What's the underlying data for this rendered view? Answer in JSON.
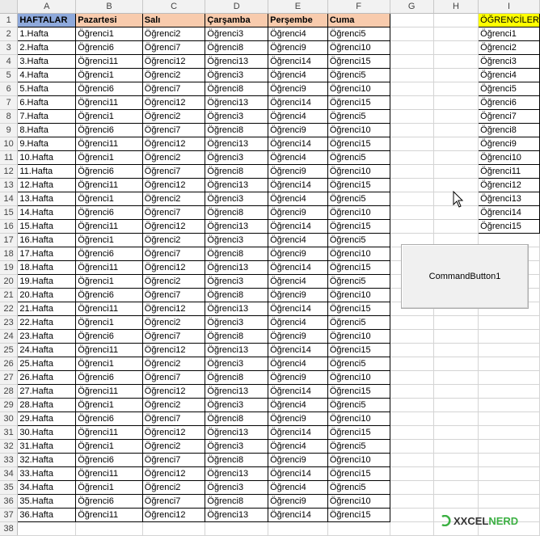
{
  "sheet": {
    "column_headers": [
      "A",
      "B",
      "C",
      "D",
      "E",
      "F",
      "G",
      "H",
      "I"
    ],
    "header_row": [
      "HAFTALAR",
      "Pazartesi",
      "Salı",
      "Çarşamba",
      "Perşembe",
      "Cuma"
    ],
    "rows": [
      [
        "1.Hafta",
        "Öğrenci1",
        "Öğrenci2",
        "Öğrenci3",
        "Öğrenci4",
        "Öğrenci5"
      ],
      [
        "2.Hafta",
        "Öğrenci6",
        "Öğrenci7",
        "Öğrenci8",
        "Öğrenci9",
        "Öğrenci10"
      ],
      [
        "3.Hafta",
        "Öğrenci11",
        "Öğrenci12",
        "Öğrenci13",
        "Öğrenci14",
        "Öğrenci15"
      ],
      [
        "4.Hafta",
        "Öğrenci1",
        "Öğrenci2",
        "Öğrenci3",
        "Öğrenci4",
        "Öğrenci5"
      ],
      [
        "5.Hafta",
        "Öğrenci6",
        "Öğrenci7",
        "Öğrenci8",
        "Öğrenci9",
        "Öğrenci10"
      ],
      [
        "6.Hafta",
        "Öğrenci11",
        "Öğrenci12",
        "Öğrenci13",
        "Öğrenci14",
        "Öğrenci15"
      ],
      [
        "7.Hafta",
        "Öğrenci1",
        "Öğrenci2",
        "Öğrenci3",
        "Öğrenci4",
        "Öğrenci5"
      ],
      [
        "8.Hafta",
        "Öğrenci6",
        "Öğrenci7",
        "Öğrenci8",
        "Öğrenci9",
        "Öğrenci10"
      ],
      [
        "9.Hafta",
        "Öğrenci11",
        "Öğrenci12",
        "Öğrenci13",
        "Öğrenci14",
        "Öğrenci15"
      ],
      [
        "10.Hafta",
        "Öğrenci1",
        "Öğrenci2",
        "Öğrenci3",
        "Öğrenci4",
        "Öğrenci5"
      ],
      [
        "11.Hafta",
        "Öğrenci6",
        "Öğrenci7",
        "Öğrenci8",
        "Öğrenci9",
        "Öğrenci10"
      ],
      [
        "12.Hafta",
        "Öğrenci11",
        "Öğrenci12",
        "Öğrenci13",
        "Öğrenci14",
        "Öğrenci15"
      ],
      [
        "13.Hafta",
        "Öğrenci1",
        "Öğrenci2",
        "Öğrenci3",
        "Öğrenci4",
        "Öğrenci5"
      ],
      [
        "14.Hafta",
        "Öğrenci6",
        "Öğrenci7",
        "Öğrenci8",
        "Öğrenci9",
        "Öğrenci10"
      ],
      [
        "15.Hafta",
        "Öğrenci11",
        "Öğrenci12",
        "Öğrenci13",
        "Öğrenci14",
        "Öğrenci15"
      ],
      [
        "16.Hafta",
        "Öğrenci1",
        "Öğrenci2",
        "Öğrenci3",
        "Öğrenci4",
        "Öğrenci5"
      ],
      [
        "17.Hafta",
        "Öğrenci6",
        "Öğrenci7",
        "Öğrenci8",
        "Öğrenci9",
        "Öğrenci10"
      ],
      [
        "18.Hafta",
        "Öğrenci11",
        "Öğrenci12",
        "Öğrenci13",
        "Öğrenci14",
        "Öğrenci15"
      ],
      [
        "19.Hafta",
        "Öğrenci1",
        "Öğrenci2",
        "Öğrenci3",
        "Öğrenci4",
        "Öğrenci5"
      ],
      [
        "20.Hafta",
        "Öğrenci6",
        "Öğrenci7",
        "Öğrenci8",
        "Öğrenci9",
        "Öğrenci10"
      ],
      [
        "21.Hafta",
        "Öğrenci11",
        "Öğrenci12",
        "Öğrenci13",
        "Öğrenci14",
        "Öğrenci15"
      ],
      [
        "22.Hafta",
        "Öğrenci1",
        "Öğrenci2",
        "Öğrenci3",
        "Öğrenci4",
        "Öğrenci5"
      ],
      [
        "23.Hafta",
        "Öğrenci6",
        "Öğrenci7",
        "Öğrenci8",
        "Öğrenci9",
        "Öğrenci10"
      ],
      [
        "24.Hafta",
        "Öğrenci11",
        "Öğrenci12",
        "Öğrenci13",
        "Öğrenci14",
        "Öğrenci15"
      ],
      [
        "25.Hafta",
        "Öğrenci1",
        "Öğrenci2",
        "Öğrenci3",
        "Öğrenci4",
        "Öğrenci5"
      ],
      [
        "26.Hafta",
        "Öğrenci6",
        "Öğrenci7",
        "Öğrenci8",
        "Öğrenci9",
        "Öğrenci10"
      ],
      [
        "27.Hafta",
        "Öğrenci11",
        "Öğrenci12",
        "Öğrenci13",
        "Öğrenci14",
        "Öğrenci15"
      ],
      [
        "28.Hafta",
        "Öğrenci1",
        "Öğrenci2",
        "Öğrenci3",
        "Öğrenci4",
        "Öğrenci5"
      ],
      [
        "29.Hafta",
        "Öğrenci6",
        "Öğrenci7",
        "Öğrenci8",
        "Öğrenci9",
        "Öğrenci10"
      ],
      [
        "30.Hafta",
        "Öğrenci11",
        "Öğrenci12",
        "Öğrenci13",
        "Öğrenci14",
        "Öğrenci15"
      ],
      [
        "31.Hafta",
        "Öğrenci1",
        "Öğrenci2",
        "Öğrenci3",
        "Öğrenci4",
        "Öğrenci5"
      ],
      [
        "32.Hafta",
        "Öğrenci6",
        "Öğrenci7",
        "Öğrenci8",
        "Öğrenci9",
        "Öğrenci10"
      ],
      [
        "33.Hafta",
        "Öğrenci11",
        "Öğrenci12",
        "Öğrenci13",
        "Öğrenci14",
        "Öğrenci15"
      ],
      [
        "34.Hafta",
        "Öğrenci1",
        "Öğrenci2",
        "Öğrenci3",
        "Öğrenci4",
        "Öğrenci5"
      ],
      [
        "35.Hafta",
        "Öğrenci6",
        "Öğrenci7",
        "Öğrenci8",
        "Öğrenci9",
        "Öğrenci10"
      ],
      [
        "36.Hafta",
        "Öğrenci11",
        "Öğrenci12",
        "Öğrenci13",
        "Öğrenci14",
        "Öğrenci15"
      ]
    ],
    "students_header": "ÖĞRENCİLER",
    "students": [
      "Öğrenci1",
      "Öğrenci2",
      "Öğrenci3",
      "Öğrenci4",
      "Öğrenci5",
      "Öğrenci6",
      "Öğrenci7",
      "Öğrenci8",
      "Öğrenci9",
      "Öğrenci10",
      "Öğrenci11",
      "Öğrenci12",
      "Öğrenci13",
      "Öğrenci14",
      "Öğrenci15"
    ],
    "colors": {
      "header_fill": "#f8cbad",
      "first_header_fill": "#8ea9db",
      "students_header_fill": "#ffff00"
    }
  },
  "command_button": {
    "label": "CommandButton1"
  },
  "watermark": {
    "text_dark": "XCEL",
    "text_green": "NERD",
    "prefix": "X"
  }
}
